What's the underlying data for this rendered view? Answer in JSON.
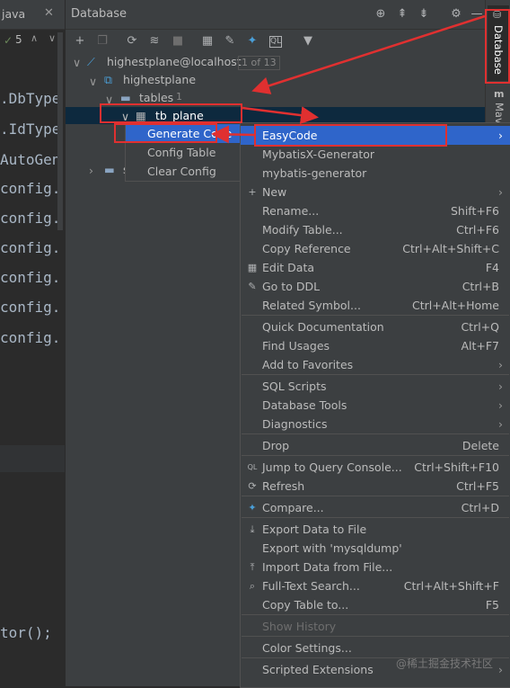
{
  "editor": {
    "tab_label": "java",
    "warning_count": "5",
    "code_lines": [
      ".DbType",
      ".IdType",
      "AutoGen",
      "config.",
      "config.",
      "config.",
      "config.",
      "config.",
      "config.",
      "tor();"
    ]
  },
  "db_panel": {
    "title": "Database",
    "right_tabs": [
      "Database",
      "Mav"
    ]
  },
  "tree": {
    "connection": "highestplane@localhost",
    "connection_badge": "1 of 13",
    "schema": "highestplane",
    "folder": "tables",
    "folder_count": "1",
    "table": "tb_plane",
    "collapsed_hint": "s"
  },
  "submenu": {
    "items": [
      "Generate Code",
      "Config Table",
      "Clear Config"
    ]
  },
  "context_menu": {
    "items": [
      {
        "label": "EasyCode",
        "shortcut": "",
        "arrow": true,
        "icon": "",
        "highlighted": true
      },
      {
        "label": "MybatisX-Generator",
        "shortcut": "",
        "arrow": false,
        "icon": ""
      },
      {
        "label": "mybatis-generator",
        "shortcut": "",
        "arrow": false,
        "icon": ""
      },
      {
        "label": "New",
        "shortcut": "",
        "arrow": true,
        "icon": "plus-icon"
      },
      {
        "label": "Rename...",
        "shortcut": "Shift+F6",
        "arrow": false,
        "icon": ""
      },
      {
        "label": "Modify Table...",
        "shortcut": "Ctrl+F6",
        "arrow": false,
        "icon": ""
      },
      {
        "label": "Copy Reference",
        "shortcut": "Ctrl+Alt+Shift+C",
        "arrow": false,
        "icon": ""
      },
      {
        "label": "Edit Data",
        "shortcut": "F4",
        "arrow": false,
        "icon": "table-icon"
      },
      {
        "label": "Go to DDL",
        "shortcut": "Ctrl+B",
        "arrow": false,
        "icon": "pencil-icon"
      },
      {
        "label": "Related Symbol...",
        "shortcut": "Ctrl+Alt+Home",
        "arrow": false,
        "icon": ""
      },
      {
        "label": "Quick Documentation",
        "shortcut": "Ctrl+Q",
        "arrow": false,
        "icon": ""
      },
      {
        "label": "Find Usages",
        "shortcut": "Alt+F7",
        "arrow": false,
        "icon": ""
      },
      {
        "label": "Add to Favorites",
        "shortcut": "",
        "arrow": true,
        "icon": ""
      },
      {
        "label": "SQL Scripts",
        "shortcut": "",
        "arrow": true,
        "icon": ""
      },
      {
        "label": "Database Tools",
        "shortcut": "",
        "arrow": true,
        "icon": ""
      },
      {
        "label": "Diagnostics",
        "shortcut": "",
        "arrow": true,
        "icon": ""
      },
      {
        "label": "Drop",
        "shortcut": "Delete",
        "arrow": false,
        "icon": ""
      },
      {
        "label": "Jump to Query Console...",
        "shortcut": "Ctrl+Shift+F10",
        "arrow": false,
        "icon": "console-icon"
      },
      {
        "label": "Refresh",
        "shortcut": "Ctrl+F5",
        "arrow": false,
        "icon": "refresh-icon"
      },
      {
        "label": "Compare...",
        "shortcut": "Ctrl+D",
        "arrow": false,
        "icon": "compare-icon"
      },
      {
        "label": "Export Data to File",
        "shortcut": "",
        "arrow": false,
        "icon": "export-icon"
      },
      {
        "label": "Export with 'mysqldump'",
        "shortcut": "",
        "arrow": false,
        "icon": ""
      },
      {
        "label": "Import Data from File...",
        "shortcut": "",
        "arrow": false,
        "icon": "import-icon"
      },
      {
        "label": "Full-Text Search...",
        "shortcut": "Ctrl+Alt+Shift+F",
        "arrow": false,
        "icon": "search-icon"
      },
      {
        "label": "Copy Table to...",
        "shortcut": "F5",
        "arrow": false,
        "icon": ""
      },
      {
        "label": "Show History",
        "shortcut": "",
        "arrow": false,
        "icon": "",
        "disabled": true
      },
      {
        "label": "Color Settings...",
        "shortcut": "",
        "arrow": false,
        "icon": ""
      },
      {
        "label": "Scripted Extensions",
        "shortcut": "",
        "arrow": true,
        "icon": ""
      }
    ]
  },
  "watermark": "@稀土掘金技术社区",
  "colors": {
    "selection": "#0d293e",
    "menu_highlight": "#2f65ca",
    "annotation_red": "#e03030"
  }
}
